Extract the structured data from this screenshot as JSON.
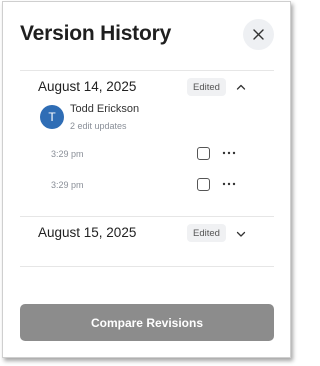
{
  "header": {
    "title": "Version History",
    "close_icon": "close-icon"
  },
  "groups": [
    {
      "date": "August 14, 2025",
      "badge": "Edited",
      "expanded": true,
      "author": {
        "initial": "T",
        "name": "Todd Erickson",
        "edit_summary": "2 edit updates"
      },
      "entries": [
        {
          "time": "3:29 pm",
          "checked": false
        },
        {
          "time": "3:29 pm",
          "checked": false
        }
      ]
    },
    {
      "date": "August 15, 2025",
      "badge": "Edited",
      "expanded": false
    }
  ],
  "footer": {
    "compare_label": "Compare Revisions"
  },
  "colors": {
    "avatar": "#2f6db5",
    "button_disabled": "#8c8c8c",
    "badge_bg": "#f0f1f3",
    "close_bg": "#eef0f3"
  }
}
